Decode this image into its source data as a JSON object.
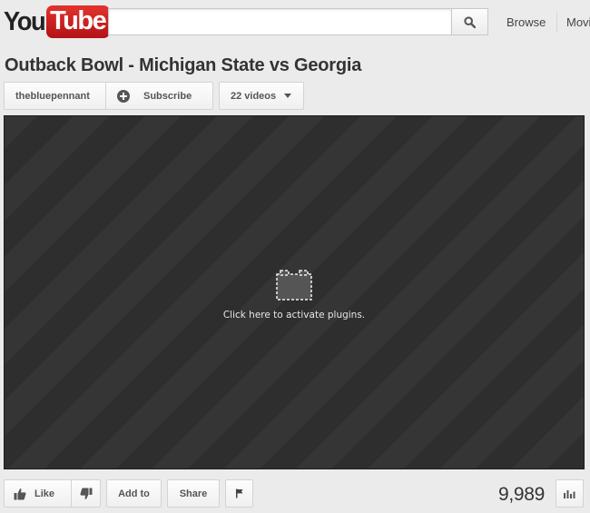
{
  "masthead": {
    "logo_you": "You",
    "logo_tube": "Tube",
    "search": {
      "value": "",
      "placeholder": ""
    },
    "nav": {
      "browse": "Browse",
      "movies": "Movi"
    }
  },
  "video": {
    "title": "Outback Bowl - Michigan State vs Georgia",
    "channel": "thebluepennant",
    "subscribe_label": "Subscribe",
    "videos_label": "22 videos"
  },
  "player": {
    "plugin_message": "Click here to activate plugins."
  },
  "actions": {
    "like_label": "Like",
    "add_to_label": "Add to",
    "share_label": "Share",
    "view_count": "9,989"
  },
  "colors": {
    "brand_red": "#cc181e",
    "page_background": "#ebebeb",
    "player_background": "#2e2e2e"
  },
  "icons": {
    "search": "search-icon",
    "subscribe": "plus-circle-icon",
    "dropdown": "caret-down-icon",
    "plugin": "plugin-icon",
    "like": "thumbs-up-icon",
    "dislike": "thumbs-down-icon",
    "flag": "flag-icon",
    "stats": "stats-bar-chart-icon"
  }
}
